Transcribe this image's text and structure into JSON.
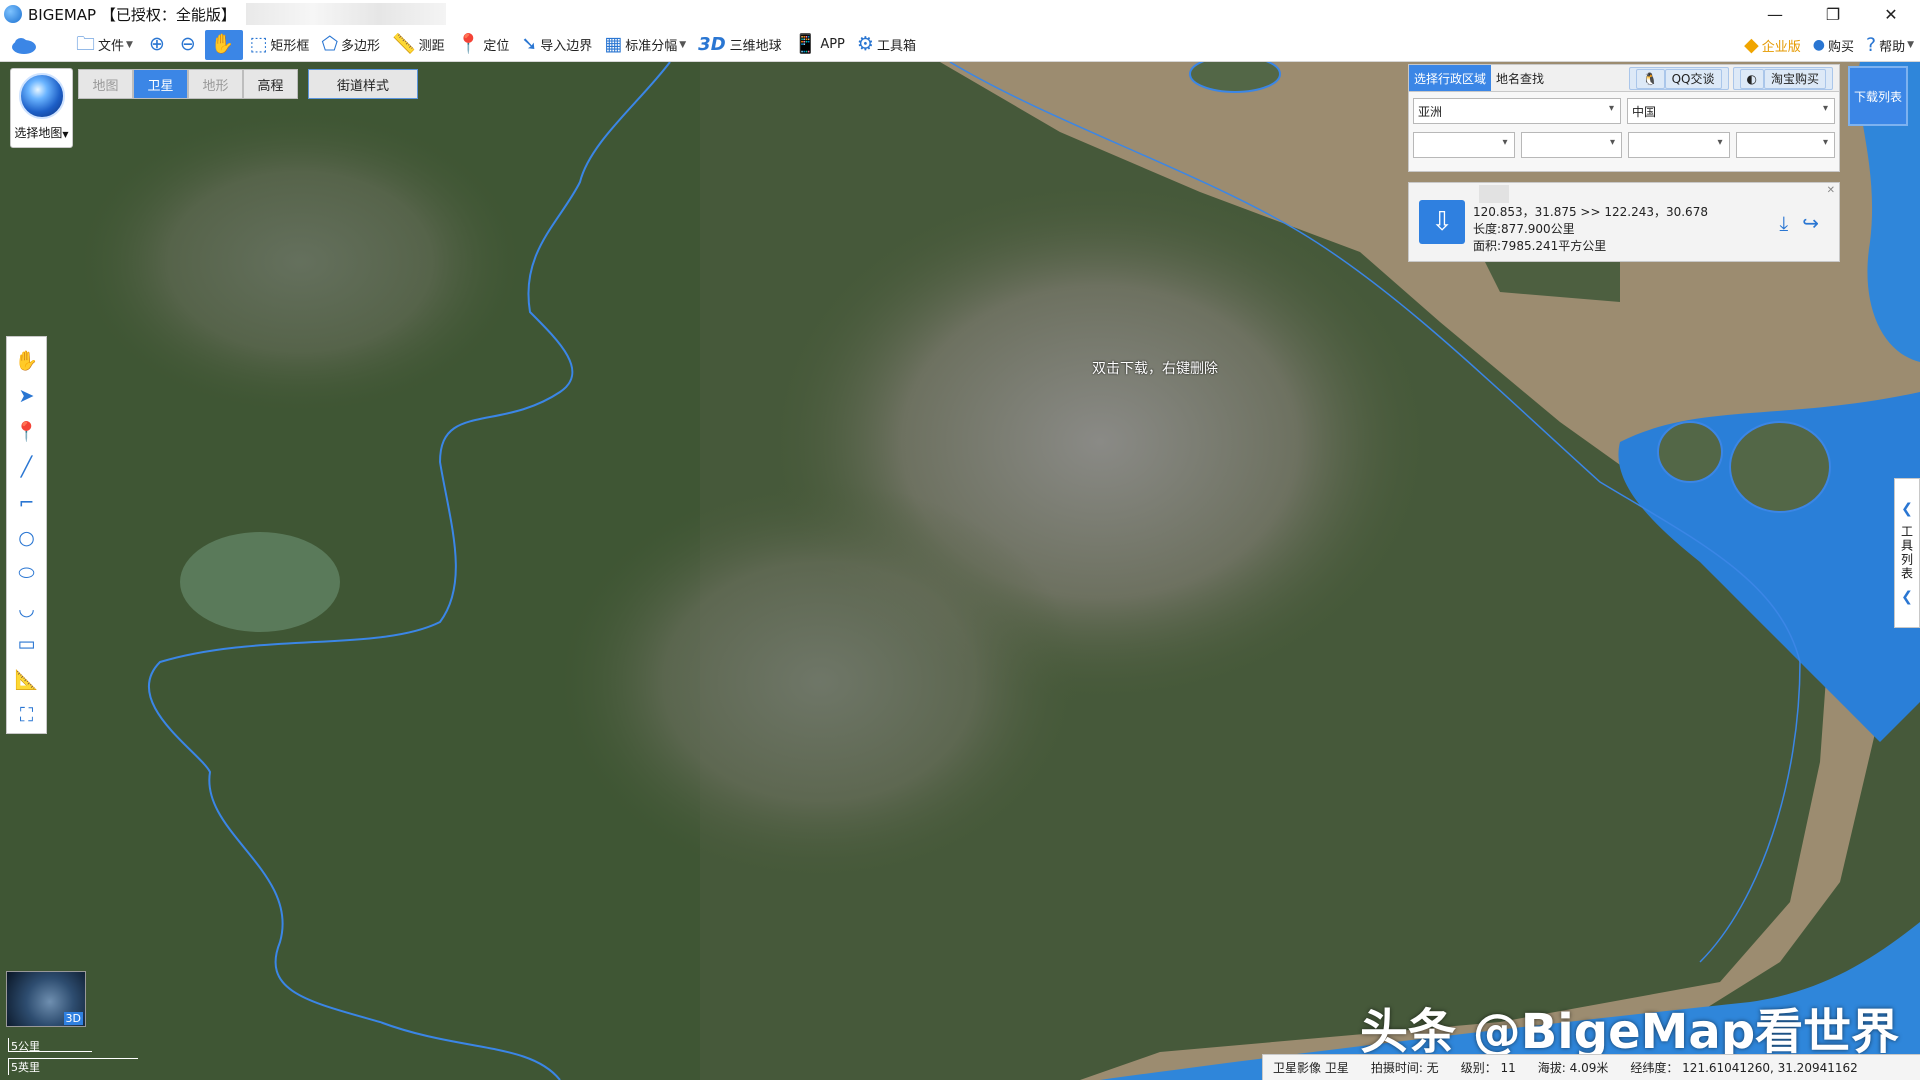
{
  "window": {
    "app_name": "BIGEMAP",
    "license": "【已授权：全能版】",
    "min": "—",
    "restore": "❐",
    "close": "✕"
  },
  "toolbar": {
    "file": "文件",
    "rect": "矩形框",
    "polygon": "多边形",
    "measure": "测距",
    "locate": "定位",
    "import_border": "导入边界",
    "standard_tiles": "标准分幅",
    "earth3d_prefix": "3D",
    "earth3d": "三维地球",
    "app": "APP",
    "toolbox": "工具箱",
    "enterprise": "企业版",
    "buy": "购买",
    "help": "帮助"
  },
  "map_type": {
    "label": "选择地图"
  },
  "layer_tabs": {
    "map": "地图",
    "satellite": "卫星",
    "terrain": "地形",
    "elevation": "高程",
    "street": "街道样式"
  },
  "panel": {
    "tab_admin": "选择行政区域",
    "tab_search": "地名查找",
    "qq": "QQ交谈",
    "taobao": "淘宝购买",
    "continent": "亚洲",
    "country": "中国",
    "selection": {
      "coords": "120.853，31.875 >> 122.243，30.678",
      "length": "长度:877.900公里",
      "area": "面积:7985.241平方公里"
    }
  },
  "download_list": "下载列表",
  "tool_list": "工具列表",
  "hint": "双击下载，右键删除",
  "mini_map": {
    "label": "3D"
  },
  "scale": {
    "km": "5公里",
    "mi": "5英里"
  },
  "watermark": "头条 @BigeMap看世界",
  "status": {
    "source": "卫星影像 卫星",
    "capture_time": "拍摄时间: 无",
    "level": "级别： 11",
    "altitude": "海拔: 4.09米",
    "lnglat": "经纬度： 121.61041260, 31.20941162"
  }
}
